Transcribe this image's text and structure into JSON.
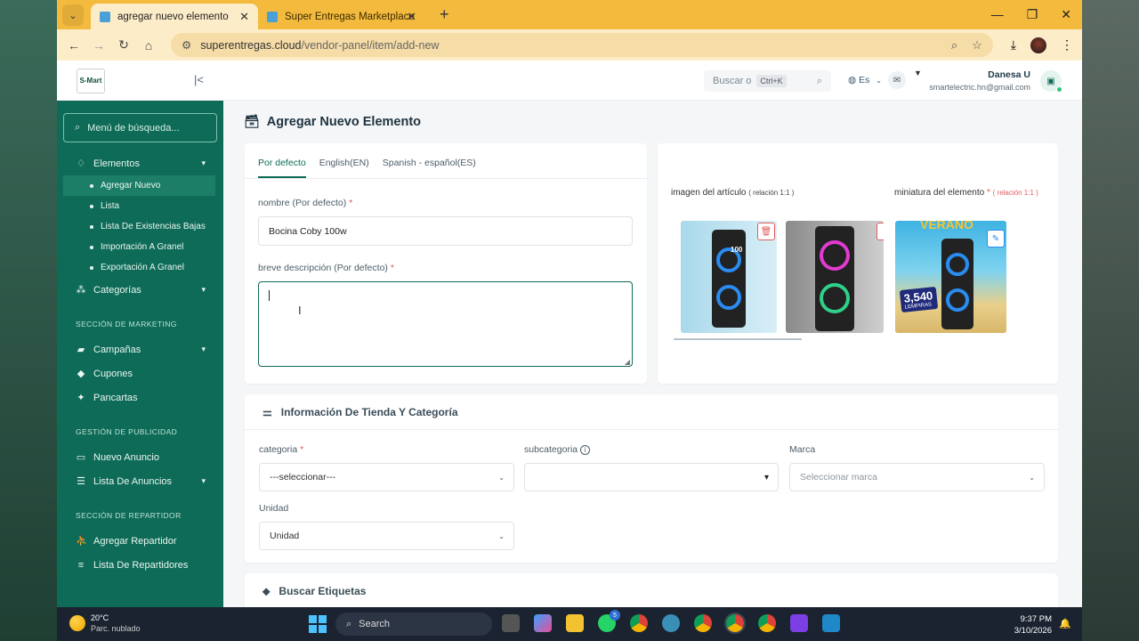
{
  "browser": {
    "tabs": [
      {
        "title": "agregar nuevo elemento",
        "active": true
      },
      {
        "title": "Super Entregas Marketplace",
        "active": false
      }
    ],
    "url_host": "superentregas.cloud",
    "url_path": "/vendor-panel/item/add-new"
  },
  "sidebar": {
    "logo_text": "S-Mart",
    "search_placeholder": "Menú de búsqueda...",
    "elementos_label": "Elementos",
    "elementos_sub": [
      "Agregar Nuevo",
      "Lista",
      "Lista De Existencias Bajas",
      "Importación A Granel",
      "Exportación A Granel"
    ],
    "categorias_label": "Categorías",
    "marketing_section": "SECCIÓN DE MARKETING",
    "campanas_label": "Campañas",
    "cupones_label": "Cupones",
    "pancartas_label": "Pancartas",
    "publicidad_section": "GESTIÓN DE PUBLICIDAD",
    "nuevo_anuncio_label": "Nuevo Anuncio",
    "lista_anuncios_label": "Lista De Anuncios",
    "repartidor_section": "SECCIÓN DE REPARTIDOR",
    "agregar_repartidor_label": "Agregar Repartidor",
    "lista_repartidores_label": "Lista De Repartidores"
  },
  "topbar": {
    "search_placeholder": "Buscar o",
    "search_shortcut": "Ctrl+K",
    "language": "Es",
    "user_name": "Danesa U",
    "user_email": "smartelectric.hn@gmail.com"
  },
  "page": {
    "title": "Agregar Nuevo Elemento",
    "lang_tabs": [
      "Por defecto",
      "English(EN)",
      "Spanish - español(ES)"
    ],
    "name_label": "nombre (Por defecto)",
    "name_value": "Bocina Coby 100w",
    "desc_label": "breve descripción (Por defecto)",
    "desc_value": "",
    "image_label": "imagen del artículo",
    "image_ratio": "( relación 1:1 )",
    "thumb_label": "miniatura del elemento",
    "thumb_ratio": "( relación 1:1 )",
    "promo_price": "3,540",
    "promo_currency": "LEMPIRAS",
    "promo_word": "VERANO",
    "img1_caption": "100",
    "store_section_title": "Información De Tienda Y Categoría",
    "categoria_label": "categoria",
    "categoria_value": "---seleccionar---",
    "subcategoria_label": "subcategoria",
    "subcategoria_value": "",
    "marca_label": "Marca",
    "marca_placeholder": "Seleccionar marca",
    "unidad_label": "Unidad",
    "unidad_value": "Unidad",
    "tags_section_title": "Buscar Etiquetas"
  },
  "taskbar": {
    "temperature": "20°C",
    "weather": "Parc. nublado",
    "search_label": "Search",
    "whatsapp_badge": "5",
    "time": "9:37 PM",
    "date": "3/10/2026"
  },
  "colors": {
    "sidebar": "#0e6b57",
    "accent": "#0e6b57",
    "browser_tabbar": "#f4ba3e",
    "required": "#e25c5c"
  }
}
